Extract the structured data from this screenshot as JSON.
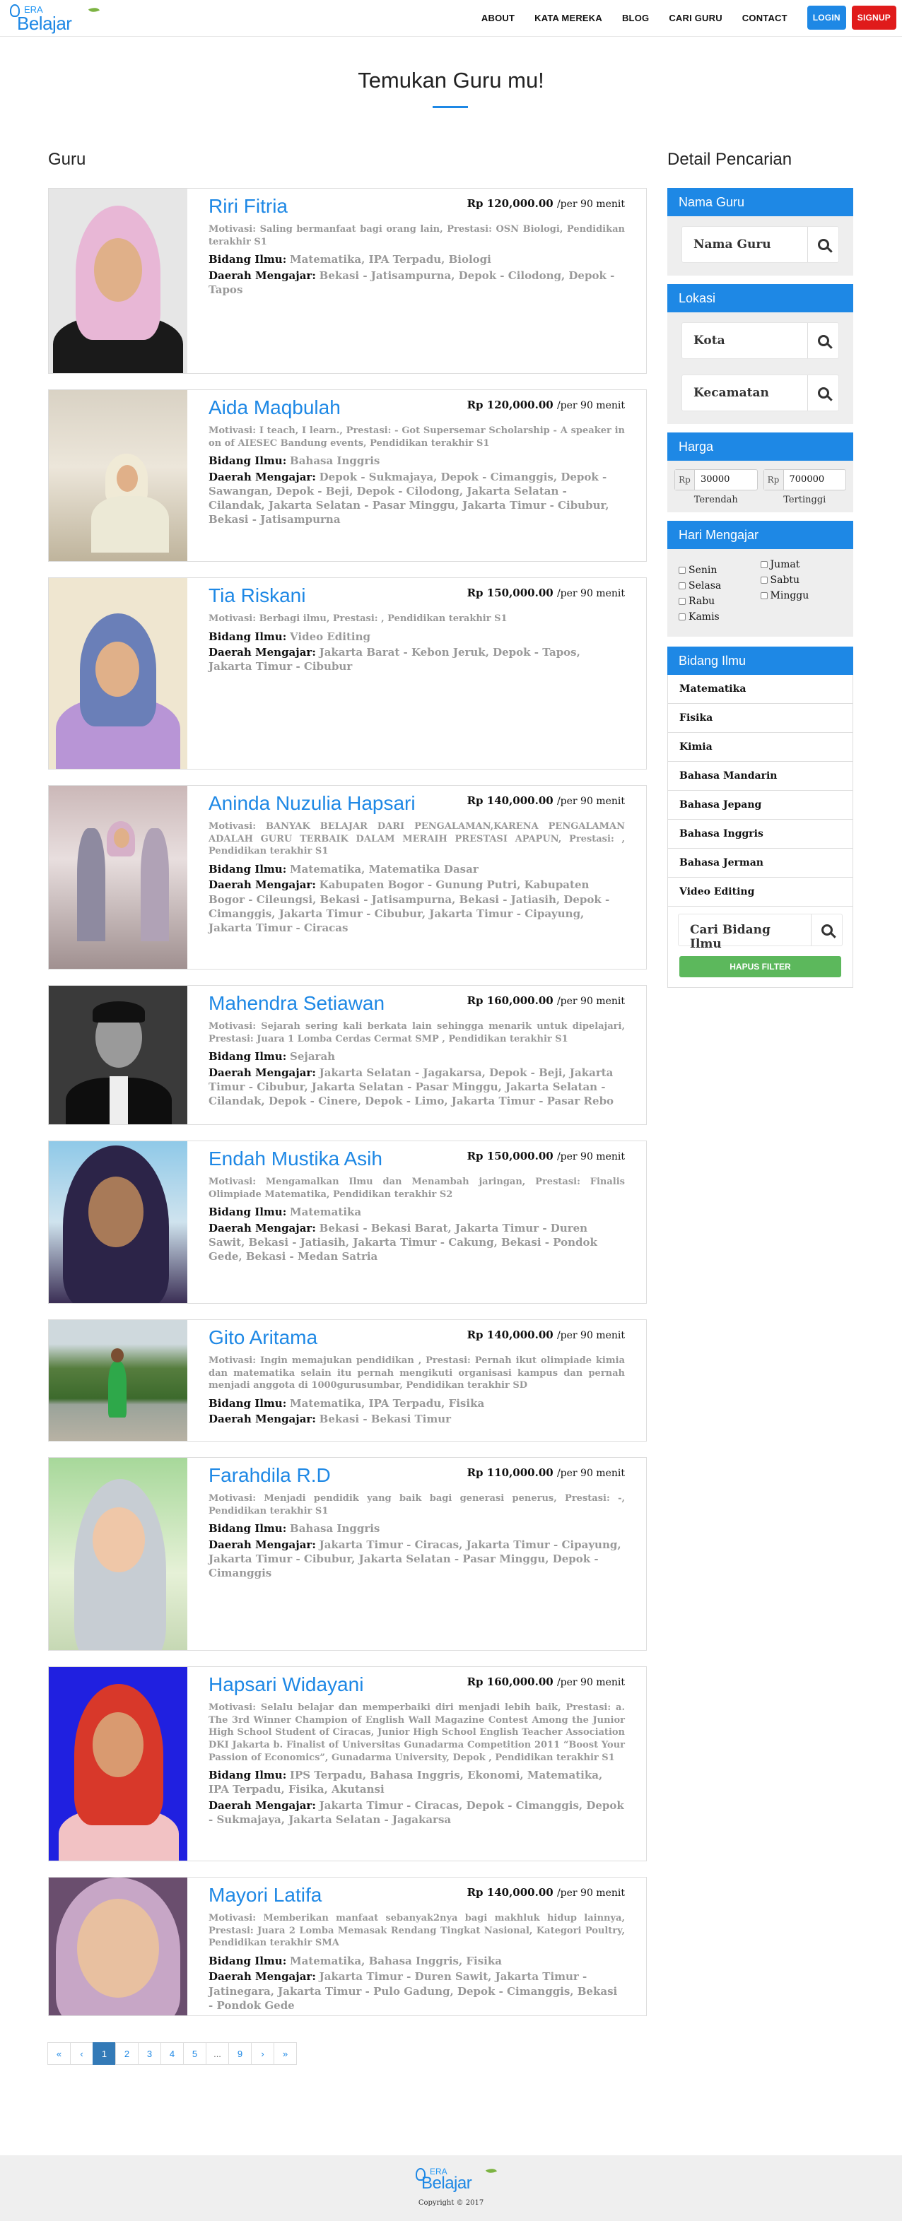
{
  "nav": {
    "logo_top": "ERA",
    "logo_main": "Belajar",
    "items": [
      "ABOUT",
      "KATA MEREKA",
      "BLOG",
      "CARI GURU",
      "CONTACT"
    ],
    "login": "LOGIN",
    "signup": "SIGNUP"
  },
  "page_title": "Temukan Guru mu!",
  "guru_heading": "Guru",
  "sidebar_heading": "Detail Pencarian",
  "labels": {
    "bidang": "Bidang Ilmu:",
    "daerah": "Daerah Mengajar:",
    "per": "/per 90 menit"
  },
  "gurus": [
    {
      "name": "Riri Fitria",
      "price": "Rp 120,000.00",
      "motivasi": "Motivasi: Saling bermanfaat bagi orang lain, Prestasi: OSN Biologi, Pendidikan terakhir S1",
      "bidang": "Matematika, IPA Terpadu, Biologi",
      "daerah": "Bekasi - Jatisampurna, Depok - Cilodong, Depok - Tapos"
    },
    {
      "name": "Aida Maqbulah",
      "price": "Rp 120,000.00",
      "motivasi": "Motivasi: I teach, I learn., Prestasi: - Got Supersemar Scholarship - A speaker in on of AIESEC Bandung events, Pendidikan terakhir S1",
      "bidang": "Bahasa Inggris",
      "daerah": "Depok - Sukmajaya, Depok - Cimanggis, Depok - Sawangan, Depok - Beji, Depok - Cilodong, Jakarta Selatan - Cilandak, Jakarta Selatan - Pasar Minggu, Jakarta Timur - Cibubur, Bekasi - Jatisampurna"
    },
    {
      "name": "Tia Riskani",
      "price": "Rp 150,000.00",
      "motivasi": "Motivasi: Berbagi ilmu, Prestasi: , Pendidikan terakhir S1",
      "bidang": "Video Editing",
      "daerah": "Jakarta Barat - Kebon Jeruk, Depok - Tapos, Jakarta Timur - Cibubur"
    },
    {
      "name": "Aninda Nuzulia Hapsari",
      "price": "Rp 140,000.00",
      "motivasi": "Motivasi: BANYAK BELAJAR DARI PENGALAMAN,KARENA PENGALAMAN ADALAH GURU TERBAIK DALAM MERAIH PRESTASI APAPUN, Prestasi: , Pendidikan terakhir S1",
      "bidang": "Matematika, Matematika Dasar",
      "daerah": "Kabupaten Bogor - Gunung Putri, Kabupaten Bogor - Cileungsi, Bekasi - Jatisampurna, Bekasi - Jatiasih, Depok - Cimanggis, Jakarta Timur - Cibubur, Jakarta Timur - Cipayung, Jakarta Timur - Ciracas"
    },
    {
      "name": "Mahendra Setiawan",
      "price": "Rp 160,000.00",
      "motivasi": "Motivasi: Sejarah sering kali berkata lain sehingga menarik untuk dipelajari, Prestasi: Juara 1 Lomba Cerdas Cermat SMP , Pendidikan terakhir S1",
      "bidang": "Sejarah",
      "daerah": "Jakarta Selatan - Jagakarsa, Depok - Beji, Jakarta Timur - Cibubur, Jakarta Selatan - Pasar Minggu, Jakarta Selatan - Cilandak, Depok - Cinere, Depok - Limo, Jakarta Timur - Pasar Rebo"
    },
    {
      "name": "Endah Mustika Asih",
      "price": "Rp 150,000.00",
      "motivasi": "Motivasi: Mengamalkan Ilmu dan Menambah jaringan, Prestasi: Finalis Olimpiade Matematika, Pendidikan terakhir S2",
      "bidang": "Matematika",
      "daerah": "Bekasi - Bekasi Barat, Jakarta Timur - Duren Sawit, Bekasi - Jatiasih, Jakarta Timur - Cakung, Bekasi - Pondok Gede, Bekasi - Medan Satria"
    },
    {
      "name": "Gito Aritama",
      "price": "Rp 140,000.00",
      "motivasi": "Motivasi: Ingin memajukan pendidikan , Prestasi: Pernah ikut olimpiade kimia dan matematika selain itu pernah mengikuti organisasi kampus dan pernah menjadi anggota di 1000gurusumbar, Pendidikan terakhir SD",
      "bidang": "Matematika, IPA Terpadu, Fisika",
      "daerah": "Bekasi - Bekasi Timur"
    },
    {
      "name": "Farahdila R.D",
      "price": "Rp 110,000.00",
      "motivasi": "Motivasi: Menjadi pendidik yang baik bagi generasi penerus, Prestasi: -, Pendidikan terakhir S1",
      "bidang": "Bahasa Inggris",
      "daerah": "Jakarta Timur - Ciracas, Jakarta Timur - Cipayung, Jakarta Timur - Cibubur, Jakarta Selatan - Pasar Minggu, Depok - Cimanggis"
    },
    {
      "name": "Hapsari Widayani",
      "price": "Rp 160,000.00",
      "motivasi": "Motivasi: Selalu belajar dan memperbaiki diri menjadi lebih baik, Prestasi: a. The 3rd Winner Champion of English Wall Magazine Contest Among the Junior High School Student of Ciracas, Junior High School English Teacher Association DKI Jakarta b. Finalist of Universitas Gunadarma Competition 2011 “Boost Your Passion of Economics”, Gunadarma University, Depok , Pendidikan terakhir S1",
      "bidang": "IPS Terpadu, Bahasa Inggris, Ekonomi, Matematika, IPA Terpadu, Fisika, Akutansi",
      "daerah": "Jakarta Timur - Ciracas, Depok - Cimanggis, Depok - Sukmajaya, Jakarta Selatan - Jagakarsa"
    },
    {
      "name": "Mayori Latifa",
      "price": "Rp 140,000.00",
      "motivasi": "Motivasi: Memberikan manfaat sebanyak2nya bagi makhluk hidup lainnya, Prestasi: Juara 2 Lomba Memasak Rendang Tingkat Nasional, Kategori Poultry, Pendidikan terakhir SMA",
      "bidang": "Matematika, Bahasa Inggris, Fisika",
      "daerah": "Jakarta Timur - Duren Sawit, Jakarta Timur - Jatinegara, Jakarta Timur - Pulo Gadung, Depok - Cimanggis, Bekasi - Pondok Gede"
    }
  ],
  "pagination": [
    "«",
    "‹",
    "1",
    "2",
    "3",
    "4",
    "5",
    "...",
    "9",
    "›",
    "»"
  ],
  "pagination_active": "1",
  "sidebar": {
    "nama_guru": {
      "title": "Nama Guru",
      "placeholder": "Nama Guru"
    },
    "lokasi": {
      "title": "Lokasi",
      "kota": "Kota",
      "kecamatan": "Kecamatan"
    },
    "harga": {
      "title": "Harga",
      "prefix": "Rp",
      "min": "30000",
      "max": "700000",
      "min_label": "Terendah",
      "max_label": "Tertinggi"
    },
    "hari": {
      "title": "Hari Mengajar",
      "col1": [
        "Senin",
        "Selasa",
        "Rabu",
        "Kamis"
      ],
      "col2": [
        "Jumat",
        "Sabtu",
        "Minggu"
      ]
    },
    "bidang": {
      "title": "Bidang Ilmu",
      "items": [
        "Matematika",
        "Fisika",
        "Kimia",
        "Bahasa Mandarin",
        "Bahasa Jepang",
        "Bahasa Inggris",
        "Bahasa Jerman",
        "Video Editing"
      ],
      "search_placeholder": "Cari Bidang Ilmu",
      "clear": "HAPUS FILTER"
    }
  },
  "footer": {
    "logo_top": "ERA",
    "logo_main": "Belajar",
    "copyright": "Copyright © 2017"
  },
  "colors": {
    "accent": "#1e88e5",
    "signup": "#e01b1b",
    "clear": "#5cb85c"
  }
}
